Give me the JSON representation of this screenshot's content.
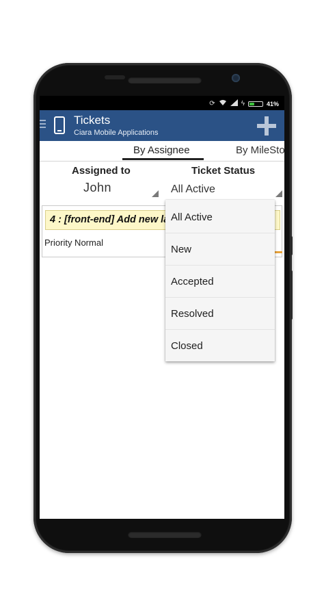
{
  "status_bar": {
    "battery_percent": "41%",
    "battery_level": 0.41,
    "icons": [
      "sync-icon",
      "wifi-icon",
      "signal-icon",
      "charging-icon",
      "battery-icon"
    ]
  },
  "app_bar": {
    "title": "Tickets",
    "subtitle": "Ciara Mobile Applications",
    "background_color": "#2b5286"
  },
  "tabs": [
    {
      "label": "By Assignee",
      "selected": true
    },
    {
      "label": "By MileSto",
      "selected": false
    }
  ],
  "filters": {
    "assigned_to_label": "Assigned to",
    "assigned_to_value": "John",
    "ticket_status_label": "Ticket Status",
    "ticket_status_value": "All Active"
  },
  "ticket": {
    "title": "4 : [front-end] Add new la",
    "priority": "Priority Normal",
    "title_background": "#fdf7c8"
  },
  "status_dropdown": {
    "options": [
      "All Active",
      "New",
      "Accepted",
      "Resolved",
      "Closed"
    ]
  }
}
